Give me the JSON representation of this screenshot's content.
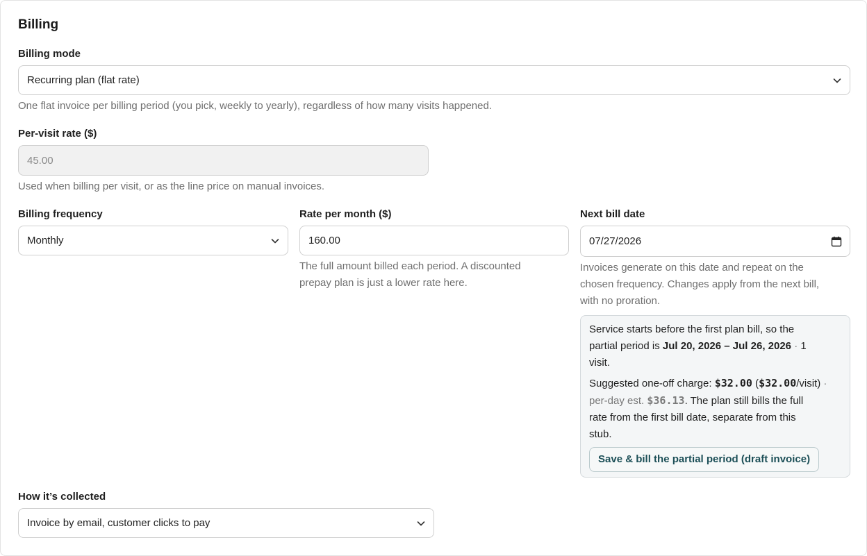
{
  "section": {
    "title": "Billing"
  },
  "billing_mode": {
    "label": "Billing mode",
    "value": "Recurring plan (flat rate)",
    "help": "One flat invoice per billing period (you pick, weekly to yearly), regardless of how many visits happened."
  },
  "per_visit": {
    "label": "Per-visit rate ($)",
    "value": "45.00",
    "help": "Used when billing per visit, or as the line price on manual invoices."
  },
  "frequency": {
    "label": "Billing frequency",
    "value": "Monthly"
  },
  "rate": {
    "label": "Rate per month ($)",
    "value": "160.00",
    "help_line1": "The full amount billed each period. A discounted",
    "help_line2": "prepay plan is just a lower rate here."
  },
  "next_bill": {
    "label": "Next bill date",
    "value": "07/27/2026",
    "help_line1": "Invoices generate on this date and repeat on the",
    "help_line2": "chosen frequency. Changes apply from the next bill,",
    "help_line3": "with no proration."
  },
  "partial": {
    "intro_line1": "Service starts before the first plan bill, so the",
    "intro_line2_pre": "partial period is ",
    "period": "Jul 20, 2026 – Jul 26, 2026",
    "sep1": " · ",
    "visits_a": "1",
    "visits_b": "visit.",
    "suggested_pre": "Suggested one-off charge: ",
    "amount": "$32.00",
    "open_paren": " (",
    "per_visit_amount": "$32.00",
    "per_visit_suffix": "/visit)",
    "sep2": " ·",
    "per_day_label": "per-day est. ",
    "per_day_amount": "$36.13",
    "plan_line1": ". The plan still bills the full",
    "plan_line2": "rate from the first bill date, separate from this",
    "plan_line3": "stub.",
    "button": "Save & bill the partial period (draft invoice)"
  },
  "collection": {
    "label": "How it’s collected",
    "value": "Invoice by email, customer clicks to pay"
  },
  "icons": {
    "chevron": "chevron-down-icon",
    "calendar": "calendar-icon"
  }
}
